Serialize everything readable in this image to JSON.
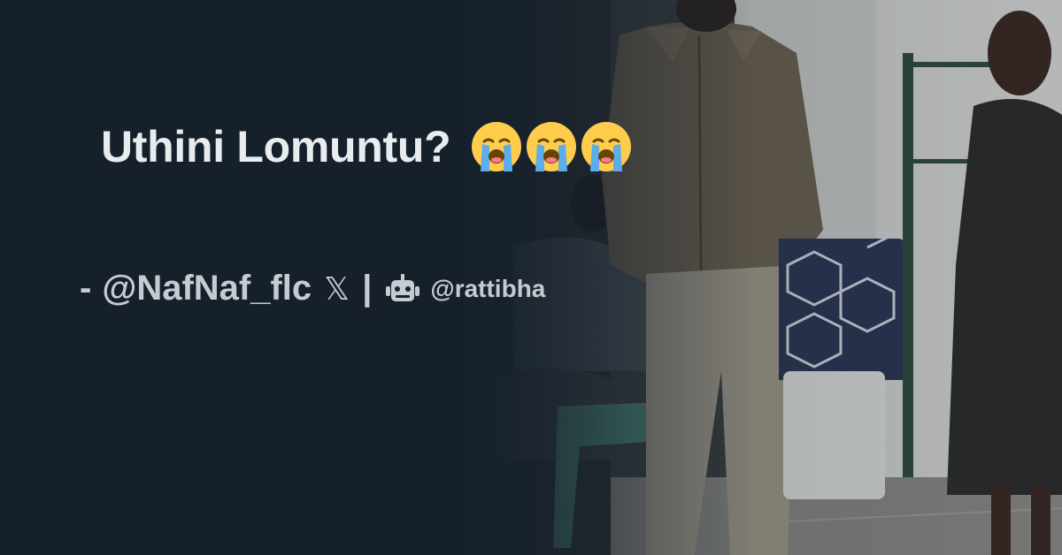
{
  "card": {
    "title": "Uthini Lomuntu?",
    "title_emojis": [
      "loudly-crying-face-icon",
      "loudly-crying-face-icon",
      "loudly-crying-face-icon"
    ],
    "credit": {
      "dash": "-",
      "author_handle": "@NafNaf_flc",
      "platform_icon": "𝕏",
      "separator": "|",
      "bot_icon": "robot-icon",
      "bot_handle": "@rattibha"
    }
  },
  "colors": {
    "background": "#15202b",
    "text": "#e9ecef",
    "muted_text": "#c5cbd1"
  }
}
